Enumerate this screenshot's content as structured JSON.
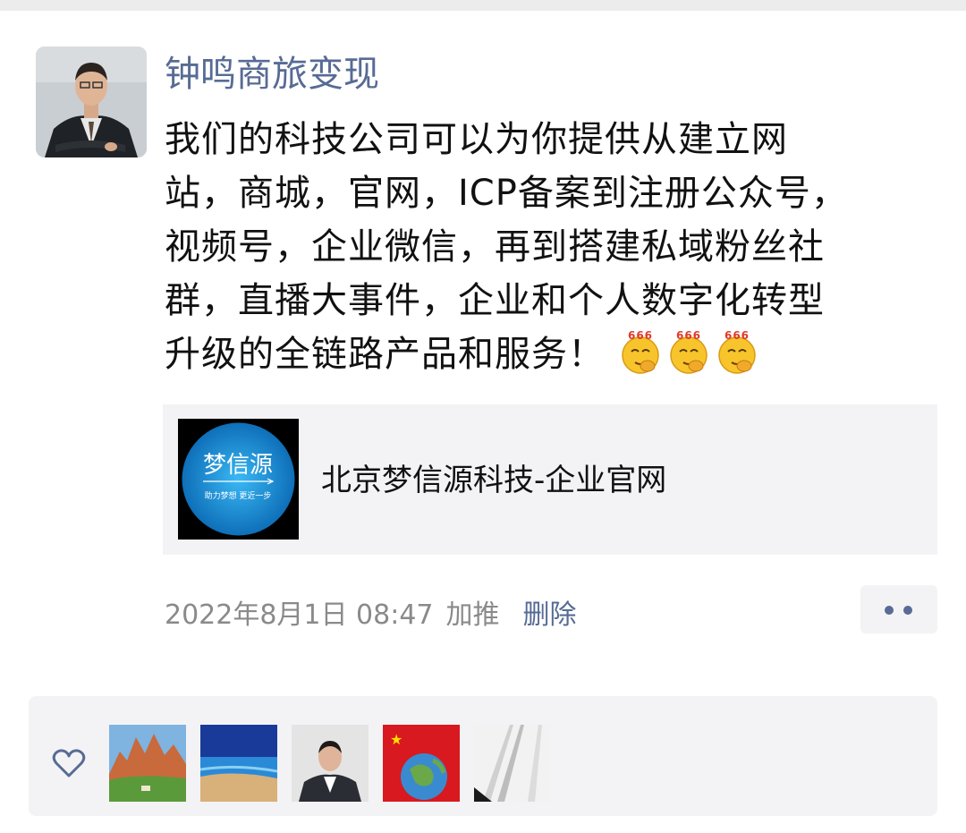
{
  "post": {
    "author": "钟鸣商旅变现",
    "text_lines": [
      "我们的科技公司可以为你提供从建立网",
      "站，商城，官网，ICP备案到注册公众号，",
      "视频号，企业微信，再到搭建私域粉丝社",
      "群，直播大事件，企业和个人数字化转型",
      "升级的全链路产品和服务！"
    ],
    "emojis": [
      {
        "icon": "666-emoji-icon",
        "label": "666"
      },
      {
        "icon": "666-emoji-icon",
        "label": "666"
      },
      {
        "icon": "666-emoji-icon",
        "label": "666"
      }
    ],
    "link_card": {
      "logo_text": "梦信源",
      "logo_slogan": "助力梦想  更近一步",
      "title": "北京梦信源科技-企业官网"
    },
    "timestamp": "2022年8月1日 08:47",
    "promo_label": "加推",
    "delete_label": "删除",
    "more_icon": "more-dots-icon"
  },
  "likes": {
    "icon": "heart-outline-icon",
    "likers": [
      {
        "avatar": "mountain-landscape-avatar"
      },
      {
        "avatar": "sea-landscape-avatar"
      },
      {
        "avatar": "man-portrait-avatar"
      },
      {
        "avatar": "china-flag-globe-avatar"
      },
      {
        "avatar": "white-architecture-avatar"
      }
    ]
  },
  "colors": {
    "link_blue": "#576b95",
    "card_bg": "#f3f3f5",
    "text": "#111111",
    "meta_grey": "#8a8a8a"
  }
}
